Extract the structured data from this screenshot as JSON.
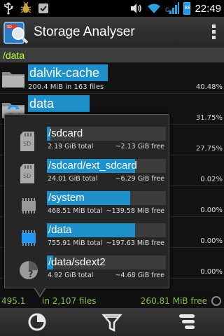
{
  "statusbar": {
    "time": "22:49",
    "battery_level": "88",
    "icons": [
      "usb-icon",
      "bug-icon",
      "check-icon",
      "volume-icon",
      "wifi-icon",
      "signal-icon",
      "battery-icon"
    ]
  },
  "app": {
    "title": "Storage Analyser",
    "icon": "storage-analyser-icon"
  },
  "path": "/data",
  "list": [
    {
      "name": "dalvik-cache",
      "sub": "200.4 MiB in 163 files",
      "percent": "40.48%",
      "icon": "folder-icon"
    },
    {
      "name": "data",
      "sub": "",
      "percent": "31.75%",
      "icon": "sync-folder-icon"
    },
    {
      "name": "",
      "sub": "",
      "percent": "27.75%",
      "icon": "folder-icon"
    },
    {
      "name": "",
      "sub": "",
      "percent": "0.02%",
      "icon": "folder-icon"
    },
    {
      "name": "",
      "sub": "",
      "percent": "0.00%",
      "icon": "folder-icon"
    },
    {
      "name": "",
      "sub": "",
      "percent": "0.00%",
      "icon": "folder-icon"
    },
    {
      "name": "",
      "sub": "",
      "percent": "0.00%",
      "icon": "folder-icon"
    }
  ],
  "footer": {
    "left": "495.1",
    "middle": "in 2,107 files",
    "right": "260.81 MiB free"
  },
  "popup": {
    "items": [
      {
        "name": "/sdcard",
        "total": "2.19 GiB total",
        "free": "~2.13 GiB free",
        "fill": 0.03,
        "icon": "sdcard-icon"
      },
      {
        "name": "/sdcard/ext_sdcard",
        "total": "24.01 GiB total",
        "free": "~6.29 GiB free",
        "fill": 0.74,
        "icon": "sdcard-icon"
      },
      {
        "name": "/system",
        "total": "468.51 MiB total",
        "free": "~139.58 MiB free",
        "fill": 0.7,
        "icon": "chip-icon"
      },
      {
        "name": "/data",
        "total": "755.91 MiB total",
        "free": "~197.63 MiB free",
        "fill": 0.74,
        "icon": "chip-blue-icon"
      },
      {
        "name": "/data/sdext2",
        "total": "4.92 GiB total",
        "free": "~4.68 GiB free",
        "fill": 0.05,
        "icon": "pie-question-icon"
      }
    ]
  },
  "bottombar": {
    "buttons": [
      "pie-chart-icon",
      "filter-icon",
      "sort-icon"
    ]
  },
  "colors": {
    "accent": "#1d8fc9",
    "path_text": "#b9ff3b",
    "footer_text": "#7ec243"
  }
}
